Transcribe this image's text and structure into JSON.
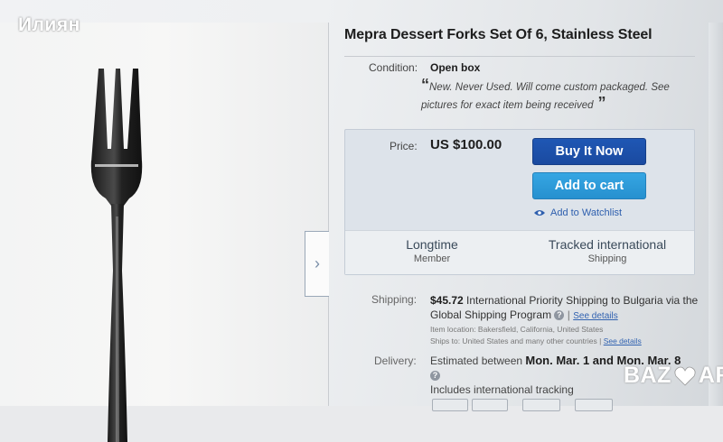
{
  "watermark": "Илиян",
  "viewer": {
    "next_arrow": "›"
  },
  "listing": {
    "title": "Mepra Dessert Forks Set Of 6, Stainless Steel",
    "condition_label": "Condition:",
    "condition_value": "Open box",
    "condition_note": "New. Never Used. Will come custom packaged. See pictures for exact item being received"
  },
  "buybox": {
    "price_label": "Price:",
    "price_value": "US $100.00",
    "buy_now": "Buy It Now",
    "add_to_cart": "Add to cart",
    "watchlist": "Add to Watchlist",
    "seller_badges": [
      {
        "title": "Longtime",
        "sub": "Member"
      },
      {
        "title": "Tracked international",
        "sub": "Shipping"
      }
    ]
  },
  "shipping": {
    "label": "Shipping:",
    "cost": "$45.72",
    "service": "International Priority Shipping to Bulgaria",
    "via": "via the Global Shipping Program",
    "see_details": "See details",
    "item_location": "Item location:  Bakersfield, California, United States",
    "ships_to": "Ships to:  United States and many other countries |",
    "see_details_2": "See details"
  },
  "delivery": {
    "label": "Delivery:",
    "estimate_prefix": "Estimated between",
    "estimate_dates": "Mon. Mar. 1 and Mon. Mar. 8",
    "tracking": "Includes international tracking"
  },
  "logo": {
    "text": "BAZAR"
  },
  "colors": {
    "buy_now": "#1f57b4",
    "add_to_cart": "#36a6e3",
    "link": "#3162b0",
    "buybox_bg": "#dde3ea"
  }
}
